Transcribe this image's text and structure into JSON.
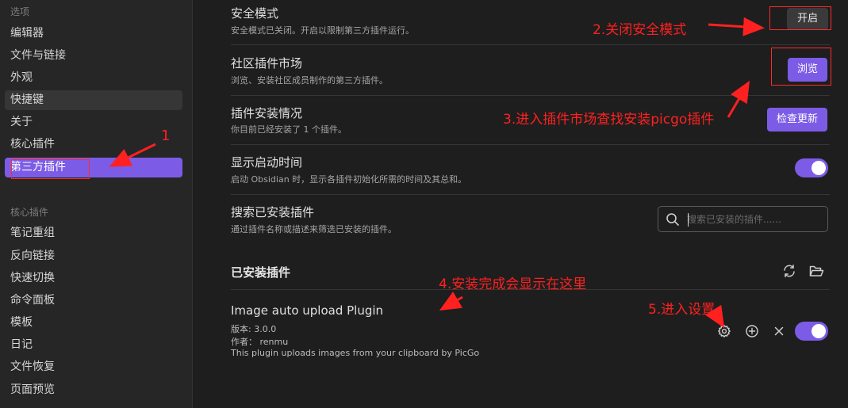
{
  "sidebar": {
    "heading_options": "选项",
    "items_options": [
      "编辑器",
      "文件与链接",
      "外观",
      "快捷键",
      "关于",
      "核心插件",
      "第三方插件"
    ],
    "heading_core": "核心插件",
    "items_core": [
      "笔记重组",
      "反向链接",
      "快速切换",
      "命令面板",
      "模板",
      "日记",
      "文件恢复",
      "页面预览"
    ]
  },
  "settings": {
    "safe_mode": {
      "title": "安全模式",
      "desc": "安全模式已关闭。开启以限制第三方插件运行。",
      "button": "开启"
    },
    "community": {
      "title": "社区插件市场",
      "desc": "浏览、安装社区成员制作的第三方插件。",
      "button": "浏览"
    },
    "installed_status": {
      "title": "插件安装情况",
      "desc": "你目前已经安装了 1 个插件。",
      "button": "检查更新"
    },
    "startup_time": {
      "title": "显示启动时间",
      "desc": "启动 Obsidian 时，显示各插件初始化所需的时间及其总和。",
      "enabled": true
    },
    "search": {
      "title": "搜索已安装插件",
      "desc": "通过插件名称或描述来筛选已安装的插件。",
      "placeholder": "搜索已安装的插件......"
    }
  },
  "installed": {
    "title": "已安装插件",
    "plugins": [
      {
        "name": "Image auto upload Plugin",
        "version": "版本: 3.0.0",
        "author": "作者： renmu",
        "description": "This plugin uploads images from your clipboard by PicGo",
        "enabled": true
      }
    ]
  },
  "annotations": {
    "a1": "1",
    "a2": "2.关闭安全模式",
    "a3": "3.进入插件市场查找安装picgo插件",
    "a4": "4.安装完成会显示在这里",
    "a5": "5.进入设置",
    "color": "#ff2020"
  },
  "colors": {
    "accent": "#7c5ce6",
    "background": "#1e1e1e",
    "sidebar": "#262626"
  },
  "icons": [
    "search-icon",
    "refresh-icon",
    "folder-open-icon",
    "gear-icon",
    "plus-circle-icon",
    "close-icon"
  ]
}
